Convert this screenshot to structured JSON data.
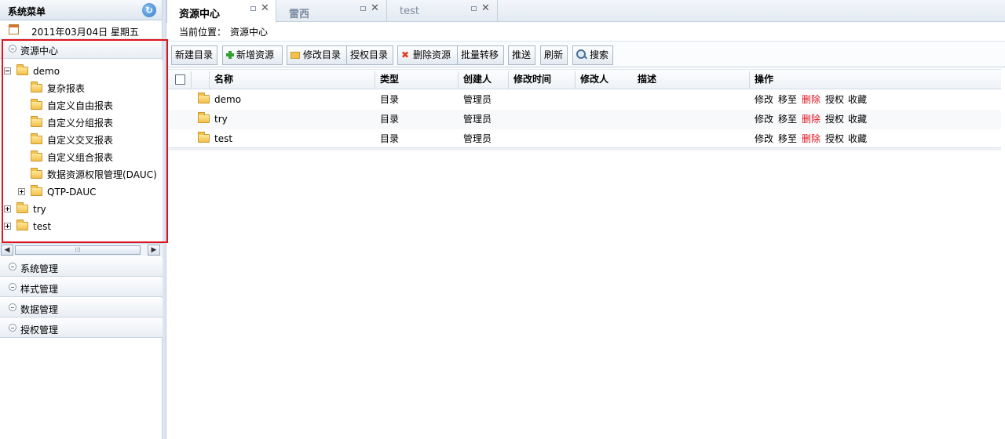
{
  "sidebar": {
    "title": "系统菜单",
    "date": "2011年03月04日  星期五",
    "resource_center": "资源中心",
    "tree": [
      {
        "label": "demo"
      },
      {
        "label": "复杂报表"
      },
      {
        "label": "自定义自由报表"
      },
      {
        "label": "自定义分组报表"
      },
      {
        "label": "自定义交叉报表"
      },
      {
        "label": "自定义组合报表"
      },
      {
        "label": "数据资源权限管理(DAUC)"
      },
      {
        "label": "QTP-DAUC"
      },
      {
        "label": "try"
      },
      {
        "label": "test"
      }
    ],
    "menus": [
      {
        "label": "系统管理"
      },
      {
        "label": "样式管理"
      },
      {
        "label": "数据管理"
      },
      {
        "label": "授权管理"
      }
    ]
  },
  "tabs": [
    {
      "label": "资源中心"
    },
    {
      "label": "雷西"
    },
    {
      "label": "test"
    }
  ],
  "breadcrumb": {
    "label": "当前位置：",
    "value": "资源中心"
  },
  "toolbar": {
    "new_folder": "新建目录",
    "add_resource": "新增资源",
    "edit_folder": "修改目录",
    "auth_folder": "授权目录",
    "delete_resource": "删除资源",
    "batch_move": "批量转移",
    "push": "推送",
    "refresh": "刷新",
    "search": "搜索"
  },
  "table": {
    "columns": {
      "name": "名称",
      "type": "类型",
      "creator": "创建人",
      "modified_time": "修改时间",
      "modifier": "修改人",
      "desc": "描述",
      "ops": "操作"
    },
    "rows": [
      {
        "name": "demo",
        "type": "目录",
        "creator": "管理员"
      },
      {
        "name": "try",
        "type": "目录",
        "creator": "管理员"
      },
      {
        "name": "test",
        "type": "目录",
        "creator": "管理员"
      }
    ],
    "actions": {
      "edit": "修改",
      "move": "移至",
      "delete": "删除",
      "auth": "授权",
      "favorite": "收藏"
    }
  },
  "colors": {
    "highlight_border": "#e0141e",
    "delete_link": "#e0141e"
  }
}
